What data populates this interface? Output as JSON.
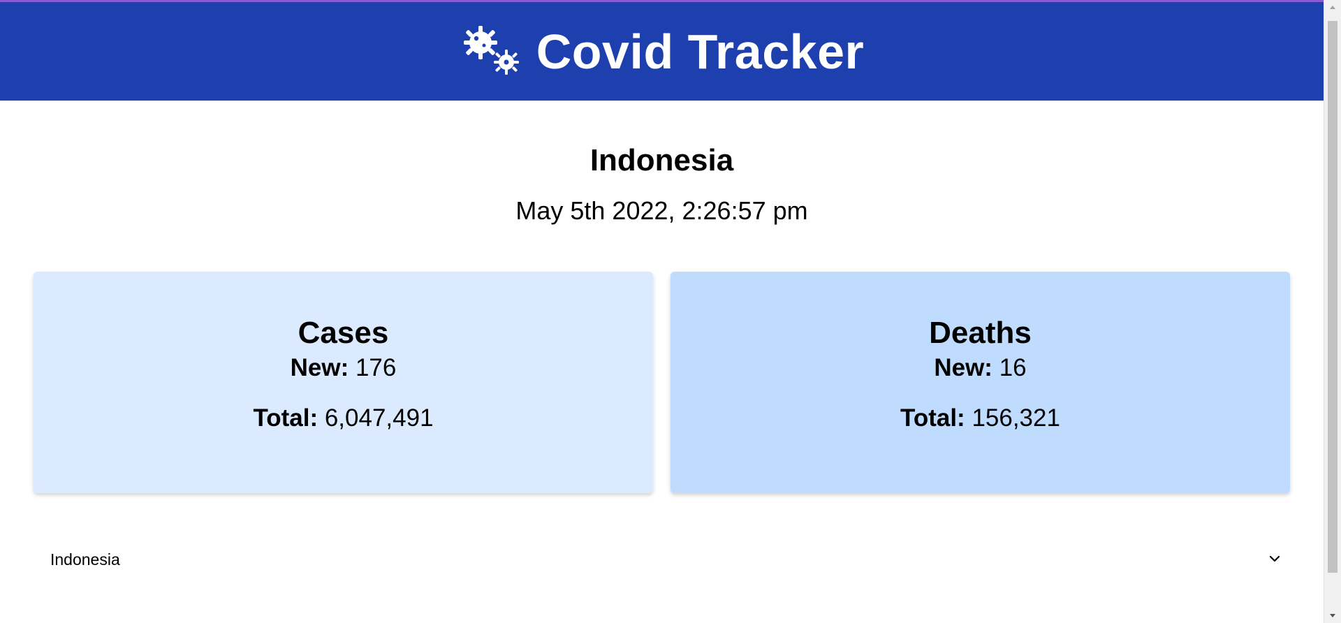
{
  "header": {
    "title": "Covid Tracker",
    "icon": "virus-icon",
    "background_color": "#1e40af"
  },
  "location": {
    "country": "Indonesia",
    "timestamp": "May 5th 2022, 2:26:57 pm"
  },
  "cards": {
    "cases": {
      "title": "Cases",
      "new_label": "New:",
      "new_value": "176",
      "total_label": "Total:",
      "total_value": "6,047,491",
      "background_color": "#dbeafe"
    },
    "deaths": {
      "title": "Deaths",
      "new_label": "New:",
      "new_value": "16",
      "total_label": "Total:",
      "total_value": "156,321",
      "background_color": "#bfdbfe"
    }
  },
  "country_select": {
    "selected": "Indonesia",
    "icon": "chevron-down-icon"
  }
}
